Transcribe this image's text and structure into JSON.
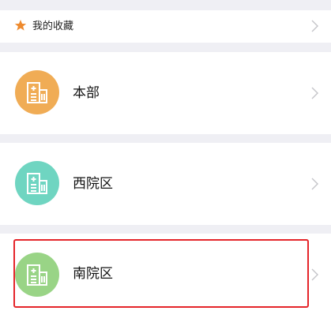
{
  "favorites": {
    "label": "我的收藏",
    "icon": "star-icon",
    "icon_color": "#ee8a2d"
  },
  "campuses": [
    {
      "label": "本部",
      "icon": "hospital-building-icon",
      "icon_bg": "#f0ac55"
    },
    {
      "label": "西院区",
      "icon": "hospital-building-icon",
      "icon_bg": "#6fd5c1"
    },
    {
      "label": "南院区",
      "icon": "hospital-building-icon",
      "icon_bg": "#99d486",
      "highlighted": true
    }
  ],
  "colors": {
    "background": "#efeff4",
    "card": "#ffffff",
    "chevron": "#c4c4c8",
    "highlight_border": "#e5252a"
  }
}
